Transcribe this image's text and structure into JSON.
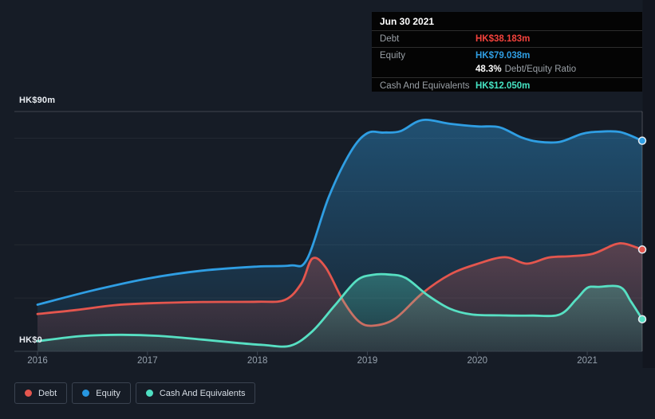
{
  "tooltip": {
    "date": "Jun 30 2021",
    "debt_label": "Debt",
    "debt_value": "HK$38.183m",
    "equity_label": "Equity",
    "equity_value": "HK$79.038m",
    "ratio_value": "48.3%",
    "ratio_label": "Debt/Equity Ratio",
    "cash_label": "Cash And Equivalents",
    "cash_value": "HK$12.050m"
  },
  "axis": {
    "y_top": "HK$90m",
    "y_bottom": "HK$0",
    "x_ticks": [
      "2016",
      "2017",
      "2018",
      "2019",
      "2020",
      "2021"
    ]
  },
  "legend": {
    "items": [
      {
        "label": "Debt",
        "color": "#e4564e"
      },
      {
        "label": "Equity",
        "color": "#2796e0"
      },
      {
        "label": "Cash And Equivalents",
        "color": "#4fdfc2"
      }
    ]
  },
  "colors": {
    "debt_line": "#e4564e",
    "equity_line": "#2f9ee3",
    "cash_line": "#57e0c3",
    "value_debt": "#f4423c",
    "value_equity": "#2f9ee3",
    "value_cash": "#45e3c3",
    "grid_faint": "rgba(255,255,255,0.06)",
    "grid_top": "rgba(255,255,255,0.18)",
    "axis_line": "#3a434f",
    "crosshair": "rgba(255,255,255,0.22)"
  },
  "chart_data": {
    "type": "area",
    "x_domain": [
      2016,
      2021.5
    ],
    "y_max": 90,
    "ylim": [
      0,
      90
    ],
    "grid": "horizontal",
    "gridline_values": [
      20,
      40,
      60,
      80
    ],
    "x_ticks": [
      2016,
      2017,
      2018,
      2019,
      2020,
      2021
    ],
    "crosshair_x": 2021.5,
    "legend_position": "bottom-left",
    "units": "HK$m",
    "series": [
      {
        "name": "Equity",
        "color": "#2f9ee3",
        "points": [
          [
            2016,
            17.5
          ],
          [
            2016.5,
            22.8
          ],
          [
            2017,
            27.3
          ],
          [
            2017.5,
            30.3
          ],
          [
            2018,
            31.8
          ],
          [
            2018.3,
            32.2
          ],
          [
            2018.45,
            34.5
          ],
          [
            2018.65,
            58
          ],
          [
            2018.85,
            75
          ],
          [
            2019,
            81.9
          ],
          [
            2019.15,
            82.1
          ],
          [
            2019.3,
            82.6
          ],
          [
            2019.5,
            86.8
          ],
          [
            2019.75,
            85.4
          ],
          [
            2020,
            84.4
          ],
          [
            2020.2,
            84.1
          ],
          [
            2020.4,
            80.3
          ],
          [
            2020.55,
            78.7
          ],
          [
            2020.75,
            78.6
          ],
          [
            2020.95,
            81.6
          ],
          [
            2021.1,
            82.4
          ],
          [
            2021.3,
            82.3
          ],
          [
            2021.5,
            79.038
          ]
        ]
      },
      {
        "name": "Debt",
        "color": "#e4564e",
        "points": [
          [
            2016,
            14
          ],
          [
            2016.35,
            15.5
          ],
          [
            2016.7,
            17.3
          ],
          [
            2017,
            18
          ],
          [
            2017.5,
            18.5
          ],
          [
            2018,
            18.6
          ],
          [
            2018.25,
            19.3
          ],
          [
            2018.4,
            25.5
          ],
          [
            2018.5,
            34.8
          ],
          [
            2018.62,
            31.5
          ],
          [
            2018.78,
            19
          ],
          [
            2018.92,
            11.3
          ],
          [
            2019.05,
            9.6
          ],
          [
            2019.25,
            12.2
          ],
          [
            2019.5,
            21.8
          ],
          [
            2019.75,
            28.8
          ],
          [
            2020,
            32.8
          ],
          [
            2020.25,
            35.3
          ],
          [
            2020.45,
            32.9
          ],
          [
            2020.65,
            35.2
          ],
          [
            2020.85,
            35.7
          ],
          [
            2021.05,
            36.6
          ],
          [
            2021.25,
            40.1
          ],
          [
            2021.35,
            40.3
          ],
          [
            2021.5,
            38.183
          ]
        ]
      },
      {
        "name": "Cash And Equivalents",
        "color": "#57e0c3",
        "points": [
          [
            2016,
            3.8
          ],
          [
            2016.4,
            5.7
          ],
          [
            2016.75,
            6.2
          ],
          [
            2017.1,
            5.8
          ],
          [
            2017.5,
            4.4
          ],
          [
            2017.8,
            3.2
          ],
          [
            2018.05,
            2.4
          ],
          [
            2018.3,
            2.1
          ],
          [
            2018.5,
            7.5
          ],
          [
            2018.7,
            17
          ],
          [
            2018.9,
            26.5
          ],
          [
            2019.05,
            28.7
          ],
          [
            2019.2,
            28.8
          ],
          [
            2019.35,
            27.5
          ],
          [
            2019.55,
            21
          ],
          [
            2019.75,
            16
          ],
          [
            2019.95,
            13.8
          ],
          [
            2020.2,
            13.5
          ],
          [
            2020.5,
            13.4
          ],
          [
            2020.75,
            13.8
          ],
          [
            2020.9,
            19.5
          ],
          [
            2021.0,
            23.8
          ],
          [
            2021.1,
            24.2
          ],
          [
            2021.3,
            24.1
          ],
          [
            2021.4,
            18.5
          ],
          [
            2021.5,
            12.05
          ]
        ]
      }
    ]
  }
}
